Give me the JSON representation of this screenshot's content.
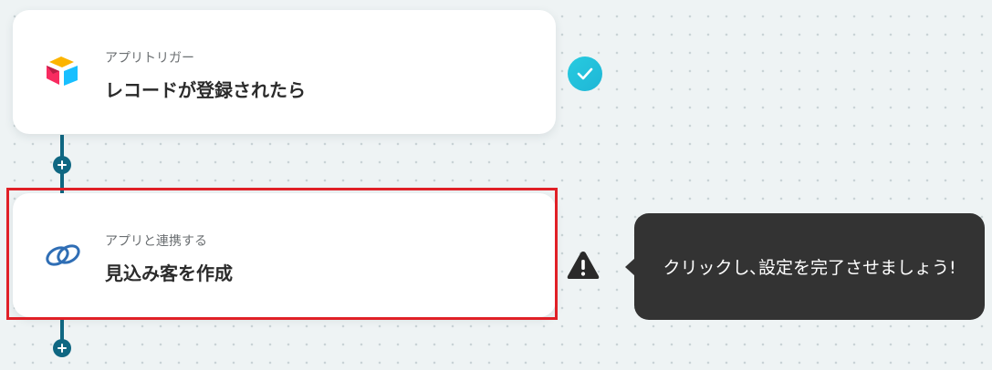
{
  "flow": {
    "steps": [
      {
        "subtitle": "アプリトリガー",
        "title": "レコードが登録されたら",
        "icon": "airtable-logo-icon",
        "status": "complete"
      },
      {
        "subtitle": "アプリと連携する",
        "title": "見込み客を作成",
        "icon": "zoho-crm-link-icon",
        "status": "warning",
        "highlighted": true
      }
    ]
  },
  "tooltip": {
    "text": "クリックし､設定を完了させましょう!"
  },
  "colors": {
    "background": "#eef3f4",
    "connector": "#0f6782",
    "check_badge": "#27cbe0",
    "highlight_border": "#e02027",
    "tooltip_bg": "#333333"
  }
}
